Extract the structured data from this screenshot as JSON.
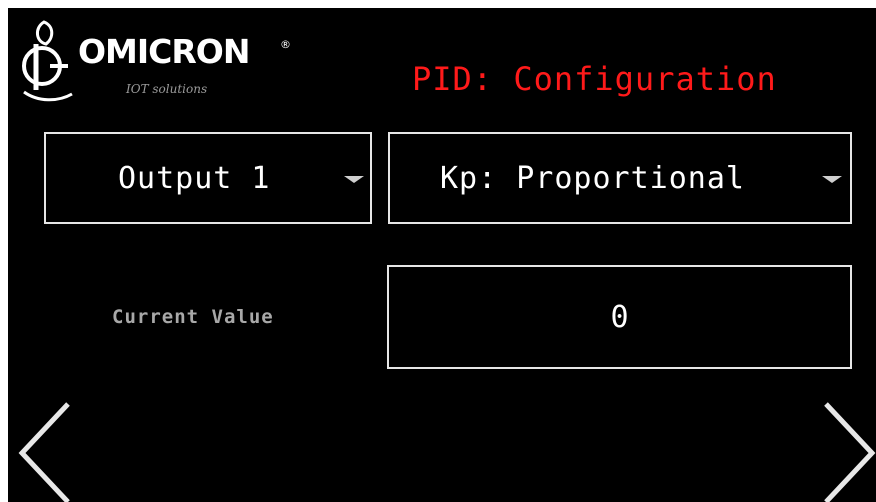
{
  "brand": {
    "name": "OMICRON",
    "registered": "®",
    "tagline": "IOT solutions"
  },
  "header": {
    "title": "PID: Configuration",
    "title_color": "#ff1a1a"
  },
  "output_select": {
    "selected": "Output 1",
    "icon": "chevron-down-icon"
  },
  "parameter_select": {
    "selected": "Kp: Proportional",
    "icon": "chevron-down-icon"
  },
  "current": {
    "label": "Current Value",
    "value": "0"
  },
  "navigation": {
    "prev_icon": "chevron-left-icon",
    "next_icon": "chevron-right-icon"
  },
  "colors": {
    "background": "#000000",
    "text": "#ffffff",
    "border": "#e6e6e6",
    "muted": "#a8a8a8"
  }
}
